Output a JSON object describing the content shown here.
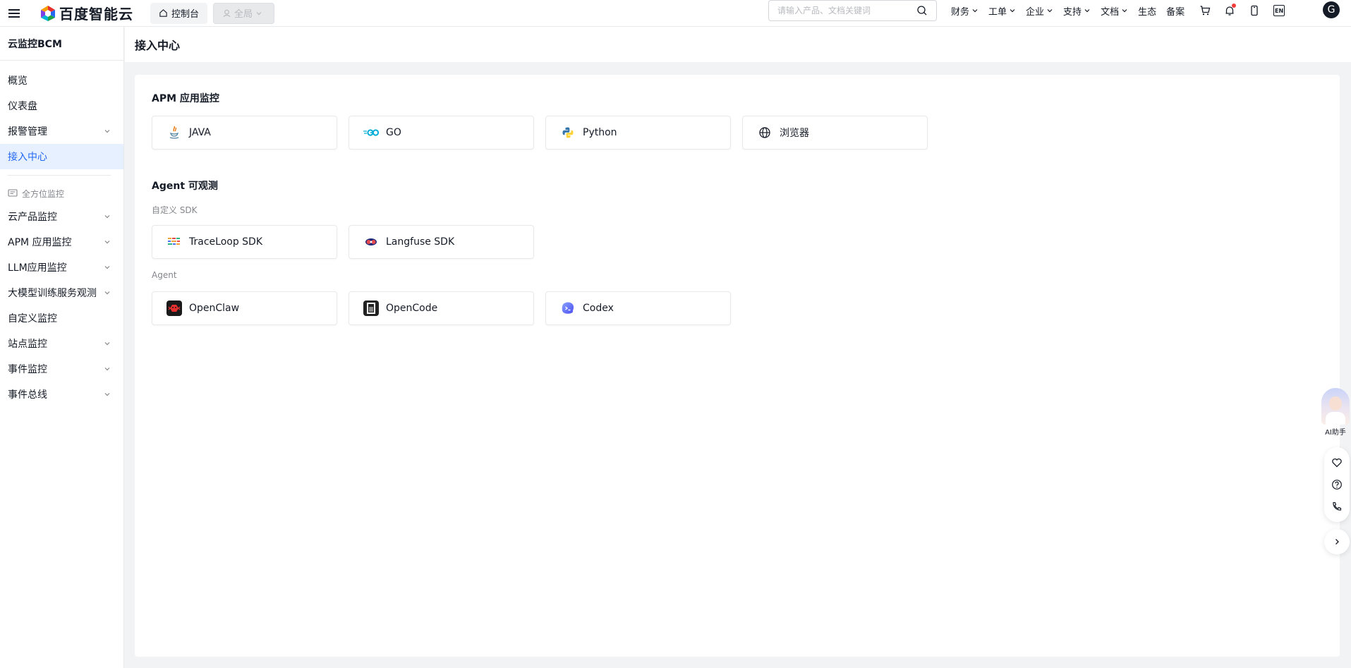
{
  "topbar": {
    "logo_text": "百度智能云",
    "console_label": "控制台",
    "region_label": "全局",
    "search_placeholder": "请输入产品、文档关键词",
    "nav": [
      "财务",
      "工单",
      "企业",
      "支持",
      "文档",
      "生态",
      "备案"
    ],
    "lang_label": "EN",
    "avatar_letter": "G"
  },
  "sidebar": {
    "title": "云监控BCM",
    "top_items": [
      {
        "label": "概览"
      },
      {
        "label": "仪表盘"
      },
      {
        "label": "报警管理"
      },
      {
        "label": "接入中心"
      }
    ],
    "group_label": "全方位监控",
    "group_items": [
      {
        "label": "云产品监控"
      },
      {
        "label": "APM 应用监控"
      },
      {
        "label": "LLM应用监控"
      },
      {
        "label": "大模型训练服务观测"
      },
      {
        "label": "自定义监控"
      },
      {
        "label": "站点监控"
      },
      {
        "label": "事件监控"
      },
      {
        "label": "事件总线"
      }
    ]
  },
  "page": {
    "title": "接入中心"
  },
  "sections": {
    "apm": {
      "title": "APM 应用监控",
      "cards": [
        {
          "label": "JAVA",
          "icon": "java-icon"
        },
        {
          "label": "GO",
          "icon": "go-icon"
        },
        {
          "label": "Python",
          "icon": "python-icon"
        },
        {
          "label": "浏览器",
          "icon": "globe-icon"
        }
      ]
    },
    "agent": {
      "title": "Agent 可观测",
      "sdk_label": "自定义 SDK",
      "sdk_cards": [
        {
          "label": "TraceLoop SDK",
          "icon": "traceloop-icon"
        },
        {
          "label": "Langfuse SDK",
          "icon": "langfuse-icon"
        }
      ],
      "agent_label": "Agent",
      "agent_cards": [
        {
          "label": "OpenClaw",
          "icon": "openclaw-icon"
        },
        {
          "label": "OpenCode",
          "icon": "opencode-icon"
        },
        {
          "label": "Codex",
          "icon": "codex-icon"
        }
      ]
    }
  },
  "float": {
    "ai_label": "AI助手"
  },
  "colors": {
    "accent": "#2468f2",
    "active_bg": "#e6f0ff",
    "text": "#151b26",
    "muted": "#84868c"
  }
}
